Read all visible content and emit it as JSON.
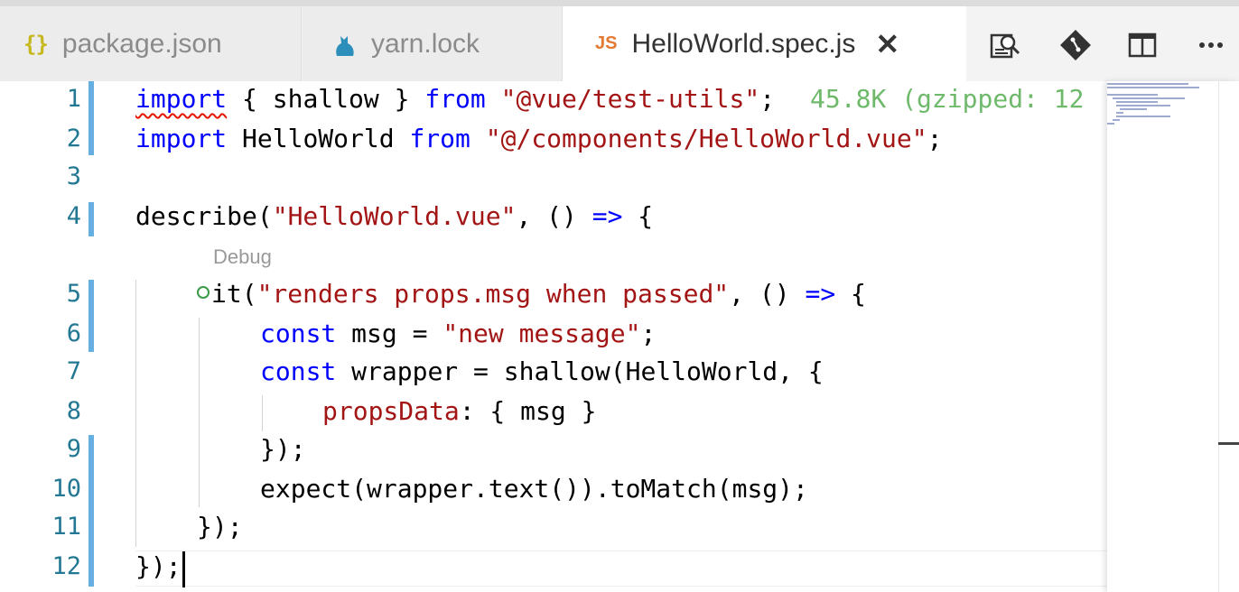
{
  "tabs": [
    {
      "label": "package.json",
      "icon": "json-braces-icon",
      "icon_text": "{}",
      "active": false
    },
    {
      "label": "yarn.lock",
      "icon": "yarn-cat-icon",
      "active": false
    },
    {
      "label": "HelloWorld.spec.js",
      "icon": "javascript-file-icon",
      "icon_text": "JS",
      "active": true,
      "close_glyph": "✕"
    }
  ],
  "toolbar": {
    "actions": [
      "open-preview-icon",
      "git-compare-icon",
      "split-editor-icon",
      "more-actions-icon"
    ]
  },
  "editor": {
    "line_numbers": [
      "1",
      "2",
      "3",
      "4",
      "5",
      "6",
      "7",
      "8",
      "9",
      "10",
      "11",
      "12"
    ],
    "codelens": "Debug",
    "import_size": "45.8K (gzipped: 12",
    "code": {
      "l1": {
        "kw1": "import",
        "t1": " { shallow } ",
        "kw2": "from",
        "t2": " ",
        "s1": "\"@vue/test-utils\"",
        "t3": ";"
      },
      "l2": {
        "kw1": "import",
        "t1": " HelloWorld ",
        "kw2": "from",
        "t2": " ",
        "s1": "\"@/components/HelloWorld.vue\"",
        "t3": ";"
      },
      "l4": {
        "t1": "describe(",
        "s1": "\"HelloWorld.vue\"",
        "t2": ", () ",
        "kw1": "=>",
        "t3": " {"
      },
      "l5": {
        "t1": "it(",
        "s1": "\"renders props.msg when passed\"",
        "t2": ", () ",
        "kw1": "=>",
        "t3": " {"
      },
      "l6": {
        "kw1": "const",
        "t1": " msg = ",
        "s1": "\"new message\"",
        "t2": ";"
      },
      "l7": {
        "kw1": "const",
        "t1": " wrapper = shallow(HelloWorld, {"
      },
      "l8": {
        "p1": "propsData",
        "t1": ": { msg }"
      },
      "l9": {
        "t1": "});"
      },
      "l10": {
        "t1": "expect(wrapper.text()).toMatch(msg);"
      },
      "l11": {
        "t1": "});"
      },
      "l12": {
        "t1": "});"
      }
    }
  },
  "colors": {
    "keyword": "#0000ff",
    "string": "#a31515",
    "line_number": "#237893",
    "gutter_marker": "#66afe0",
    "size_annotation": "#6fb96b"
  }
}
